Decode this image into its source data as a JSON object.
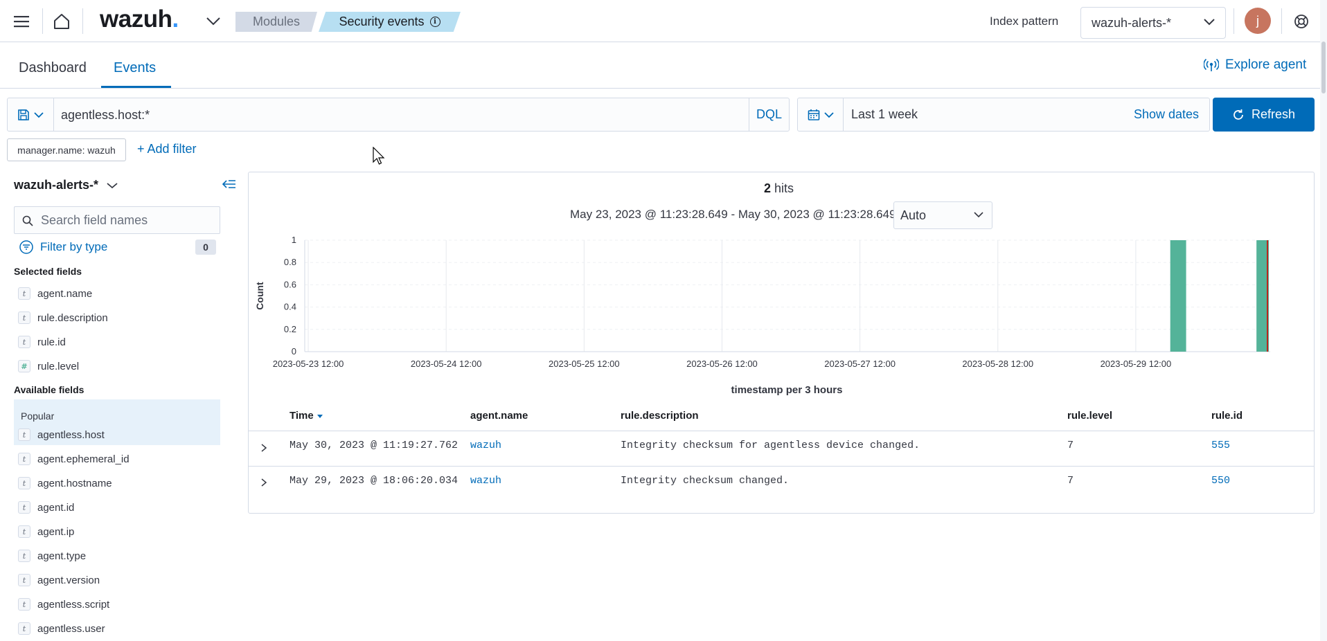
{
  "header": {
    "logo_text": "wazuh",
    "logo_dot": ".",
    "breadcrumbs": [
      "Modules",
      "Security events"
    ],
    "info_glyph": "i",
    "index_pattern_label": "Index pattern",
    "index_pattern_value": "wazuh-alerts-*",
    "avatar_initial": "j"
  },
  "tabs": {
    "dashboard": "Dashboard",
    "events": "Events",
    "active": "Events",
    "explore_agent": "Explore agent"
  },
  "query": {
    "value": "agentless.host:*",
    "language": "DQL",
    "date_range": "Last 1 week",
    "show_dates": "Show dates",
    "refresh": "Refresh"
  },
  "filters": {
    "pill": "manager.name: wazuh",
    "add_filter": "+ Add filter"
  },
  "sidebar": {
    "index_pattern": "wazuh-alerts-*",
    "search_placeholder": "Search field names",
    "filter_by_type": "Filter by type",
    "filter_count": "0",
    "selected_heading": "Selected fields",
    "selected_fields": [
      {
        "type": "t",
        "name": "agent.name"
      },
      {
        "type": "t",
        "name": "rule.description"
      },
      {
        "type": "t",
        "name": "rule.id"
      },
      {
        "type": "#",
        "name": "rule.level"
      }
    ],
    "available_heading": "Available fields",
    "popular_label": "Popular",
    "available_fields": [
      {
        "type": "t",
        "name": "agentless.host"
      },
      {
        "type": "t",
        "name": "agent.ephemeral_id"
      },
      {
        "type": "t",
        "name": "agent.hostname"
      },
      {
        "type": "t",
        "name": "agent.id"
      },
      {
        "type": "t",
        "name": "agent.ip"
      },
      {
        "type": "t",
        "name": "agent.type"
      },
      {
        "type": "t",
        "name": "agent.version"
      },
      {
        "type": "t",
        "name": "agentless.script"
      },
      {
        "type": "t",
        "name": "agentless.user"
      }
    ]
  },
  "results": {
    "hits_count": "2",
    "hits_label": "hits",
    "time_range": "May 23, 2023 @ 11:23:28.649 - May 30, 2023 @ 11:23:28.649",
    "interval": "Auto",
    "columns": [
      "Time",
      "agent.name",
      "rule.description",
      "rule.level",
      "rule.id"
    ],
    "rows": [
      {
        "time": "May 30, 2023 @ 11:19:27.762",
        "agent": "wazuh",
        "description": "Integrity checksum for agentless device changed.",
        "level": "7",
        "rule_id": "555"
      },
      {
        "time": "May 29, 2023 @ 18:06:20.034",
        "agent": "wazuh",
        "description": "Integrity checksum changed.",
        "level": "7",
        "rule_id": "550"
      }
    ]
  },
  "chart_data": {
    "type": "bar",
    "ylabel": "Count",
    "xlabel": "timestamp per 3 hours",
    "ylim": [
      0,
      1
    ],
    "yticks": [
      "0",
      "0.2",
      "0.4",
      "0.6",
      "0.8",
      "1"
    ],
    "xticks": [
      "2023-05-23 12:00",
      "2023-05-24 12:00",
      "2023-05-25 12:00",
      "2023-05-26 12:00",
      "2023-05-27 12:00",
      "2023-05-28 12:00",
      "2023-05-29 12:00"
    ],
    "xrange": [
      "2023-05-23 11:23:28.649",
      "2023-05-30 11:23:28.649"
    ],
    "series": [
      {
        "values": [
          {
            "x": "2023-05-29 18:00",
            "y": 1
          },
          {
            "x": "2023-05-30 09:00",
            "y": 1
          }
        ]
      }
    ],
    "bar_color": "#54b399",
    "now_marker_color": "#bd271e",
    "grid": true
  }
}
